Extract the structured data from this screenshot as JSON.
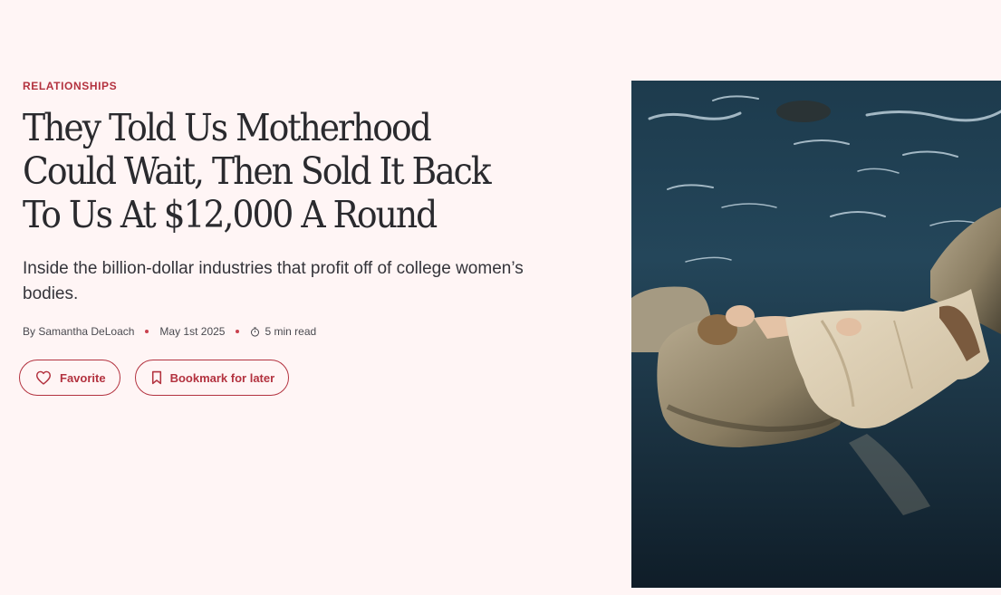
{
  "article": {
    "category": "RELATIONSHIPS",
    "headline": "They Told Us Motherhood Could Wait, Then Sold It Back To Us At $12,000 A Round",
    "dek": "Inside the billion-dollar industries that profit off of college women’s bodies.",
    "byline": "By Samantha DeLoach",
    "date": "May 1st 2025",
    "read_time": "5 min read"
  },
  "actions": {
    "favorite_label": "Favorite",
    "bookmark_label": "Bookmark for later"
  },
  "icons": {
    "favorite": "heart-icon",
    "bookmark": "bookmark-icon",
    "read_time": "clock-icon"
  },
  "colors": {
    "background": "#fff5f5",
    "accent": "#b3323f",
    "text": "#2a2a2e"
  }
}
